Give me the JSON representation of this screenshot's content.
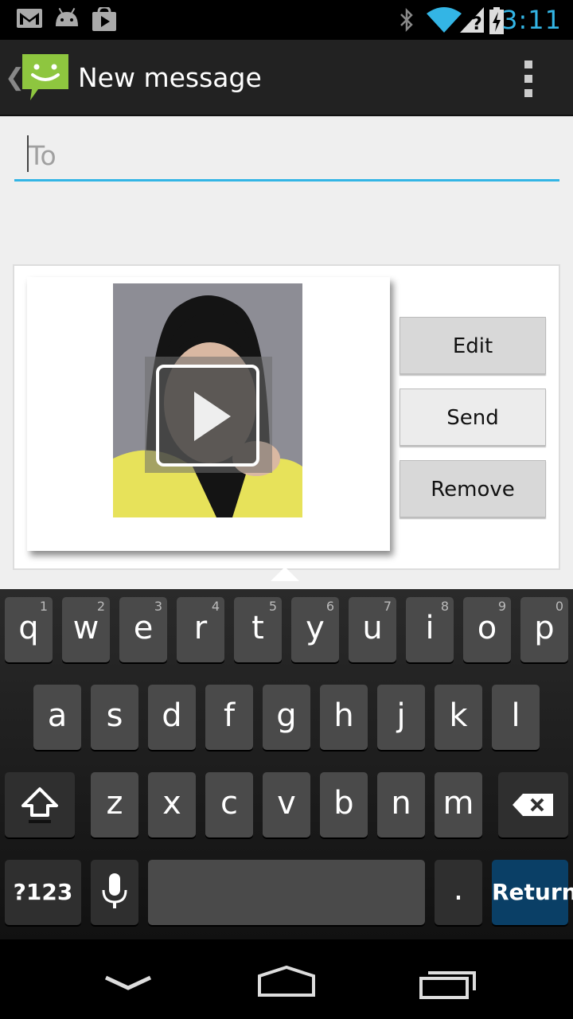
{
  "status_bar": {
    "time": "3:11",
    "icons": [
      "gmail-icon",
      "android-debug-icon",
      "play-store-icon",
      "bluetooth-icon",
      "wifi-icon",
      "signal-icon",
      "battery-charging-icon"
    ],
    "clock_color": "#33b5e5"
  },
  "action_bar": {
    "title": "New message",
    "icons": [
      "up-caret-icon",
      "messaging-app-icon",
      "overflow-menu-icon"
    ]
  },
  "compose": {
    "to_placeholder": "To",
    "to_value": "",
    "accent_color": "#33b5e5"
  },
  "attachment": {
    "type": "video",
    "icons": [
      "play-icon"
    ],
    "buttons": {
      "edit": "Edit",
      "send": "Send",
      "remove": "Remove"
    }
  },
  "keyboard": {
    "row1": [
      {
        "key": "q",
        "hint": "1"
      },
      {
        "key": "w",
        "hint": "2"
      },
      {
        "key": "e",
        "hint": "3"
      },
      {
        "key": "r",
        "hint": "4"
      },
      {
        "key": "t",
        "hint": "5"
      },
      {
        "key": "y",
        "hint": "6"
      },
      {
        "key": "u",
        "hint": "7"
      },
      {
        "key": "i",
        "hint": "8"
      },
      {
        "key": "o",
        "hint": "9"
      },
      {
        "key": "p",
        "hint": "0"
      }
    ],
    "row2": [
      "a",
      "s",
      "d",
      "f",
      "g",
      "h",
      "j",
      "k",
      "l"
    ],
    "row3": [
      "z",
      "x",
      "c",
      "v",
      "b",
      "n",
      "m"
    ],
    "symbols_label": "?123",
    "period_label": ".",
    "return_label": "Return",
    "icons": [
      "shift-icon",
      "backspace-icon",
      "microphone-icon"
    ]
  },
  "nav_bar": {
    "icons": [
      "back-icon",
      "home-icon",
      "recents-icon"
    ]
  }
}
